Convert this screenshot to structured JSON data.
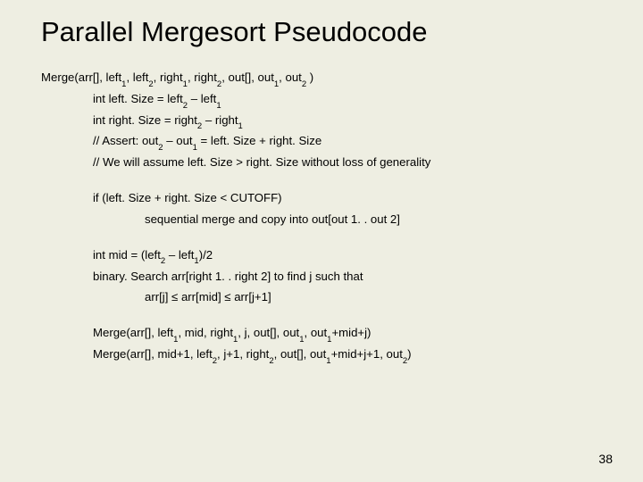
{
  "title": "Parallel Mergesort Pseudocode",
  "lines": {
    "sig": "Merge(arr[], left<sub>1</sub>, left<sub>2</sub>, right<sub>1</sub>, right<sub>2</sub>, out[], out<sub>1</sub>, out<sub>2</sub> )",
    "leftSize": "int left. Size = left<sub>2</sub> – left<sub>1</sub>",
    "rightSize": "int right. Size = right<sub>2</sub> – right<sub>1</sub>",
    "assert": "// Assert: out<sub>2</sub> – out<sub>1</sub> = left. Size + right. Size",
    "assume": "// We will assume left. Size > right. Size without loss of generality",
    "ifcut": "if (left. Size + right. Size < CUTOFF)",
    "seqmerge": "sequential merge and copy into out[out 1. . out 2]",
    "mid": "int mid = (left<sub>2</sub> – left<sub>1</sub>)/2",
    "bsearch": "binary. Search arr[right 1. . right 2] to find j such that",
    "arrj": "arr[j] ≤ arr[mid] ≤ arr[j+1]",
    "merge1": "Merge(arr[], left<sub>1</sub>, mid, right<sub>1</sub>, j, out[], out<sub>1</sub>, out<sub>1</sub>+mid+j)",
    "merge2": "Merge(arr[], mid+1, left<sub>2</sub>, j+1, right<sub>2</sub>, out[], out<sub>1</sub>+mid+j+1, out<sub>2</sub>)"
  },
  "pageNumber": "38"
}
